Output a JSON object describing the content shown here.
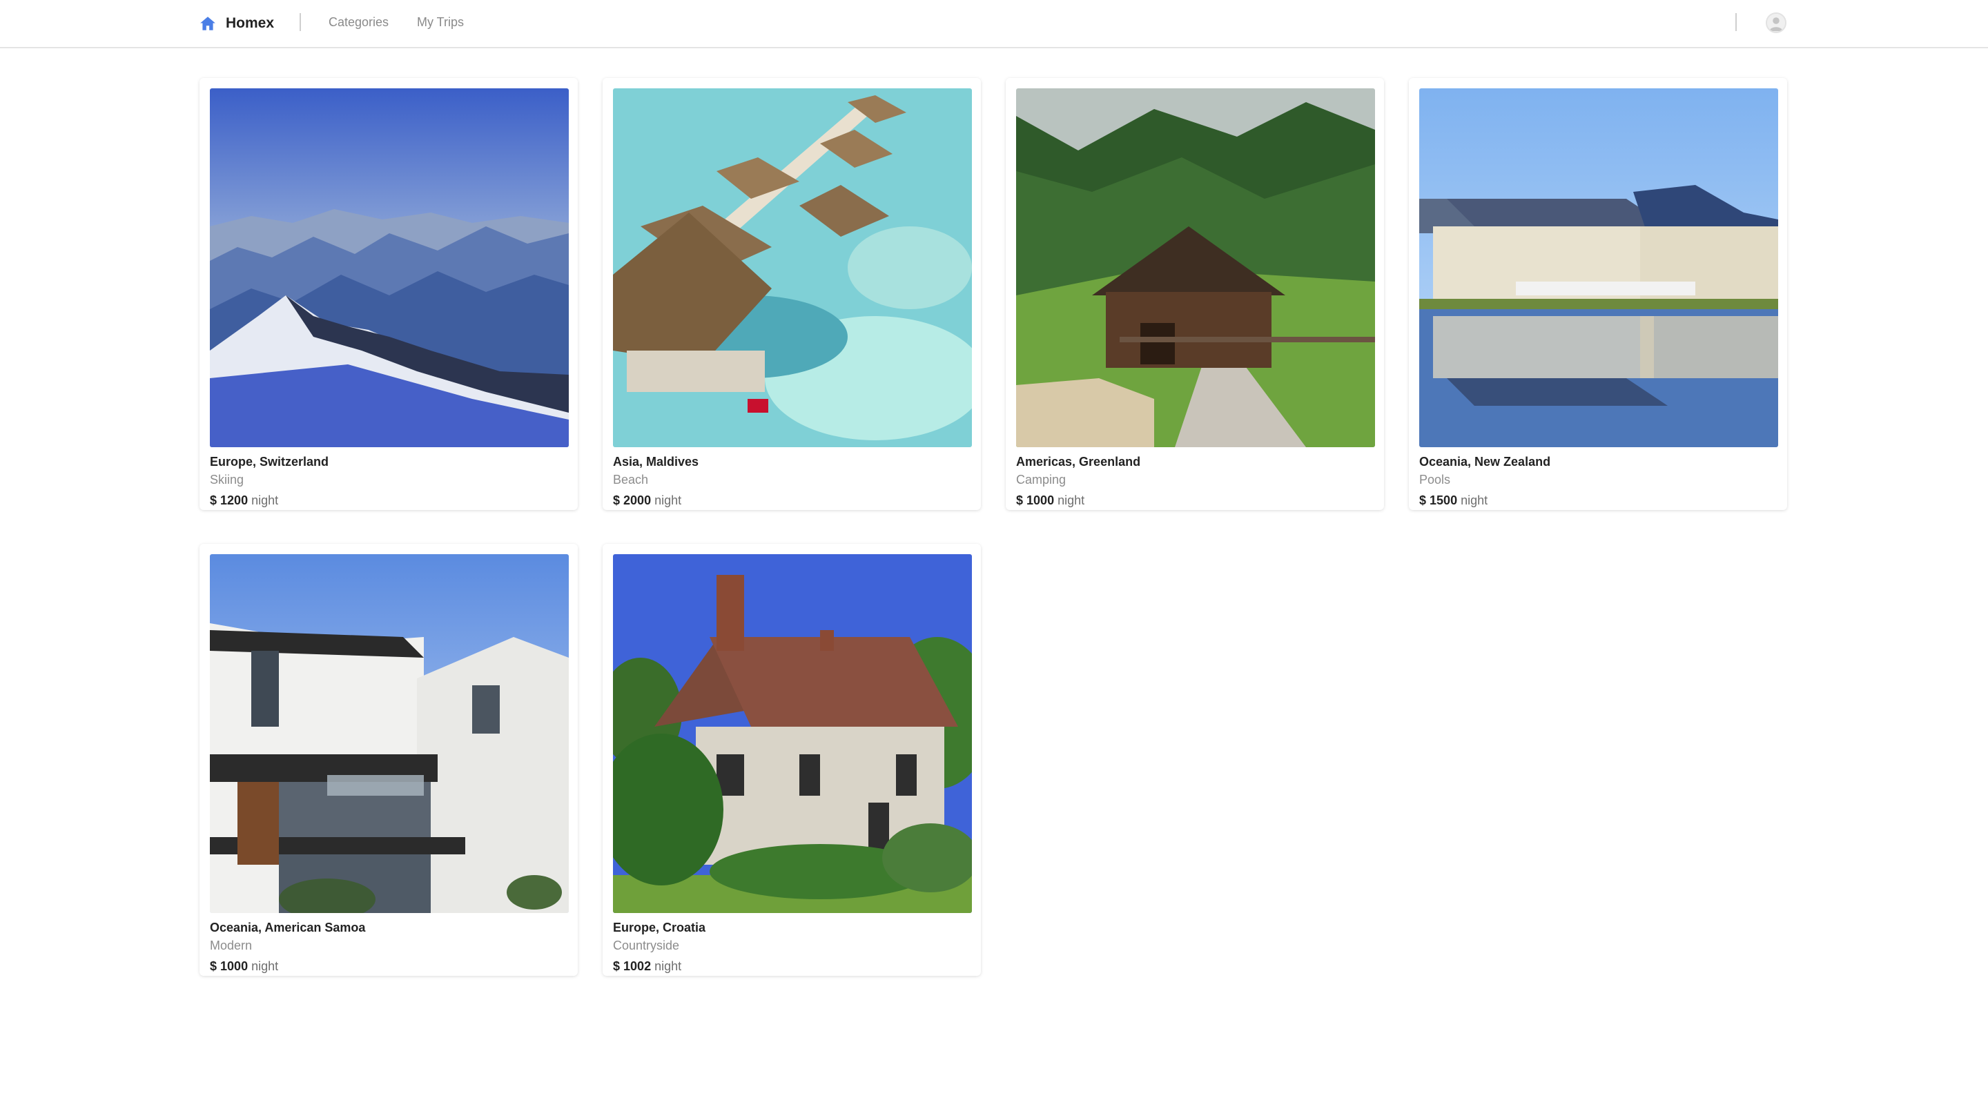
{
  "app": {
    "brand": "Homex",
    "icons": {
      "brand": "house-icon",
      "avatar": "user-avatar-icon"
    },
    "accent_color": "#4a7ee6"
  },
  "nav": {
    "links": [
      {
        "label": "Categories"
      },
      {
        "label": "My Trips"
      }
    ]
  },
  "listings": [
    {
      "title": "Europe, Switzerland",
      "category": "Skiing",
      "currency": "$",
      "price": "1200",
      "unit": "night",
      "image": "snowy-mountains"
    },
    {
      "title": "Asia, Maldives",
      "category": "Beach",
      "currency": "$",
      "price": "2000",
      "unit": "night",
      "image": "overwater-bungalows"
    },
    {
      "title": "Americas, Greenland",
      "category": "Camping",
      "currency": "$",
      "price": "1000",
      "unit": "night",
      "image": "wooden-cabin-forest"
    },
    {
      "title": "Oceania, New Zealand",
      "category": "Pools",
      "currency": "$",
      "price": "1500",
      "unit": "night",
      "image": "lake-house-reflection"
    },
    {
      "title": "Oceania, American Samoa",
      "category": "Modern",
      "currency": "$",
      "price": "1000",
      "unit": "night",
      "image": "modern-house"
    },
    {
      "title": "Europe, Croatia",
      "category": "Countryside",
      "currency": "$",
      "price": "1002",
      "unit": "night",
      "image": "brick-cottage"
    }
  ]
}
